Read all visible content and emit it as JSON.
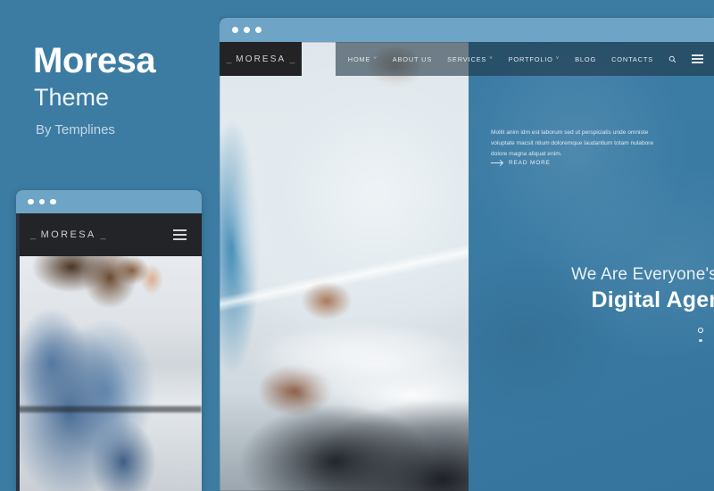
{
  "brand": {
    "title": "Moresa",
    "subtitle": "Theme",
    "author": "By Templines"
  },
  "colors": {
    "panel_blue": "#3c7ca3",
    "chrome_blue": "#6ea4c5",
    "nav_dark": "#232326",
    "hero_overlay": "#3b7ca5"
  },
  "main_window": {
    "chrome": {
      "dot_1": "window-dot",
      "dot_2": "window-dot",
      "dot_3": "window-dot"
    },
    "nav": {
      "logo": "MORESA",
      "logo_dash_left": "_",
      "logo_dash_right": "_",
      "items": [
        {
          "label": "HOME",
          "has_caret": true,
          "caret": "˅"
        },
        {
          "label": "ABOUT US",
          "has_caret": false,
          "caret": ""
        },
        {
          "label": "SERVICES",
          "has_caret": true,
          "caret": "˅"
        },
        {
          "label": "PORTFOLIO",
          "has_caret": true,
          "caret": "˅"
        },
        {
          "label": "BLOG",
          "has_caret": false,
          "caret": ""
        },
        {
          "label": "CONTACTS",
          "has_caret": false,
          "caret": ""
        }
      ],
      "search_icon": "search-icon",
      "menu_icon": "hamburger-menu-icon"
    },
    "hero": {
      "heading_line1": "We Are Everyone's",
      "heading_line2": "Digital Agency",
      "paragraph": "Mollit anim idm est laborum sed ut perspiciatis unde omniste voluptate macsit ntium doloremque laudantium totam nulabore dolore magna aliquat enim.",
      "cta_label": "READ MORE",
      "cta_icon": "arrow-right-icon",
      "carousel": {
        "active_index": 0,
        "count": 2
      }
    },
    "photo_alt": "person in white shirt holding pen over documents"
  },
  "mini_window": {
    "chrome": {
      "dot_1": "window-dot",
      "dot_2": "window-dot",
      "dot_3": "window-dot"
    },
    "nav": {
      "logo": "MORESA",
      "logo_dash_left": "_",
      "logo_dash_right": "_",
      "menu_icon": "hamburger-menu-icon"
    },
    "photo_alt": "woman in blue denim shirt in profile"
  }
}
